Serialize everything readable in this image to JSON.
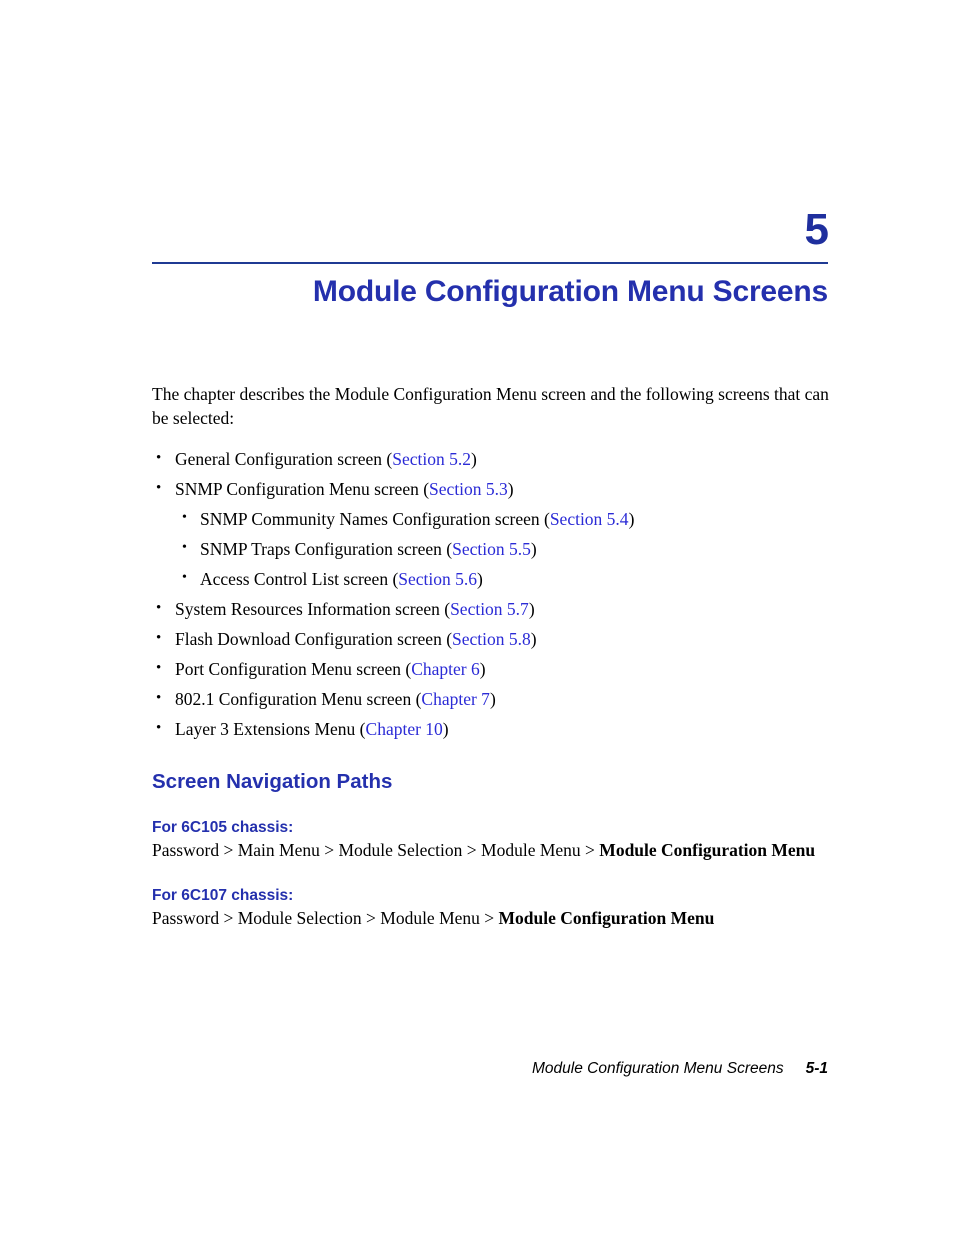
{
  "chapter": {
    "number": "5",
    "title": "Module Configuration Menu Screens"
  },
  "intro": "The chapter describes the Module Configuration Menu screen and the following screens that can be selected:",
  "bullets": [
    {
      "text": "General Configuration screen (",
      "link": "Section 5.2",
      "tail": ")"
    },
    {
      "text": "SNMP Configuration Menu screen (",
      "link": "Section 5.3",
      "tail": ")"
    }
  ],
  "nested_bullets": [
    {
      "text": "SNMP Community Names Configuration screen (",
      "link": "Section 5.4",
      "tail": ")"
    },
    {
      "text": "SNMP Traps Configuration screen (",
      "link": "Section 5.5",
      "tail": ")"
    },
    {
      "text": "Access Control List screen (",
      "link": "Section 5.6",
      "tail": ")"
    }
  ],
  "bullets_after": [
    {
      "text": "System Resources Information screen (",
      "link": "Section 5.7",
      "tail": ")"
    },
    {
      "text": "Flash Download Configuration screen (",
      "link": "Section 5.8",
      "tail": ")"
    },
    {
      "text": "Port Configuration Menu screen (",
      "link": "Chapter 6",
      "tail": ")"
    },
    {
      "text": "802.1 Configuration Menu screen (",
      "link": "Chapter 7",
      "tail": ")"
    },
    {
      "text": "Layer 3 Extensions Menu (",
      "link": "Chapter 10",
      "tail": ")"
    }
  ],
  "navigation": {
    "heading": "Screen Navigation Paths",
    "paths": [
      {
        "sub_heading": "For 6C105 chassis:",
        "prefix": "Password > Main Menu > Module Selection > Module Menu > ",
        "bold": "Module Configuration Menu"
      },
      {
        "sub_heading": "For 6C107 chassis:",
        "prefix": "Password > Module Selection > Module Menu > ",
        "bold": "Module Configuration Menu"
      }
    ]
  },
  "footer": {
    "running_head": "Module Configuration Menu Screens",
    "page_number": "5-1"
  },
  "colors": {
    "heading_blue": "#2430ad",
    "rule_blue": "#1f3a93",
    "link_blue": "#2b2bd6",
    "text_black": "#000000",
    "page_background": "#ffffff"
  }
}
